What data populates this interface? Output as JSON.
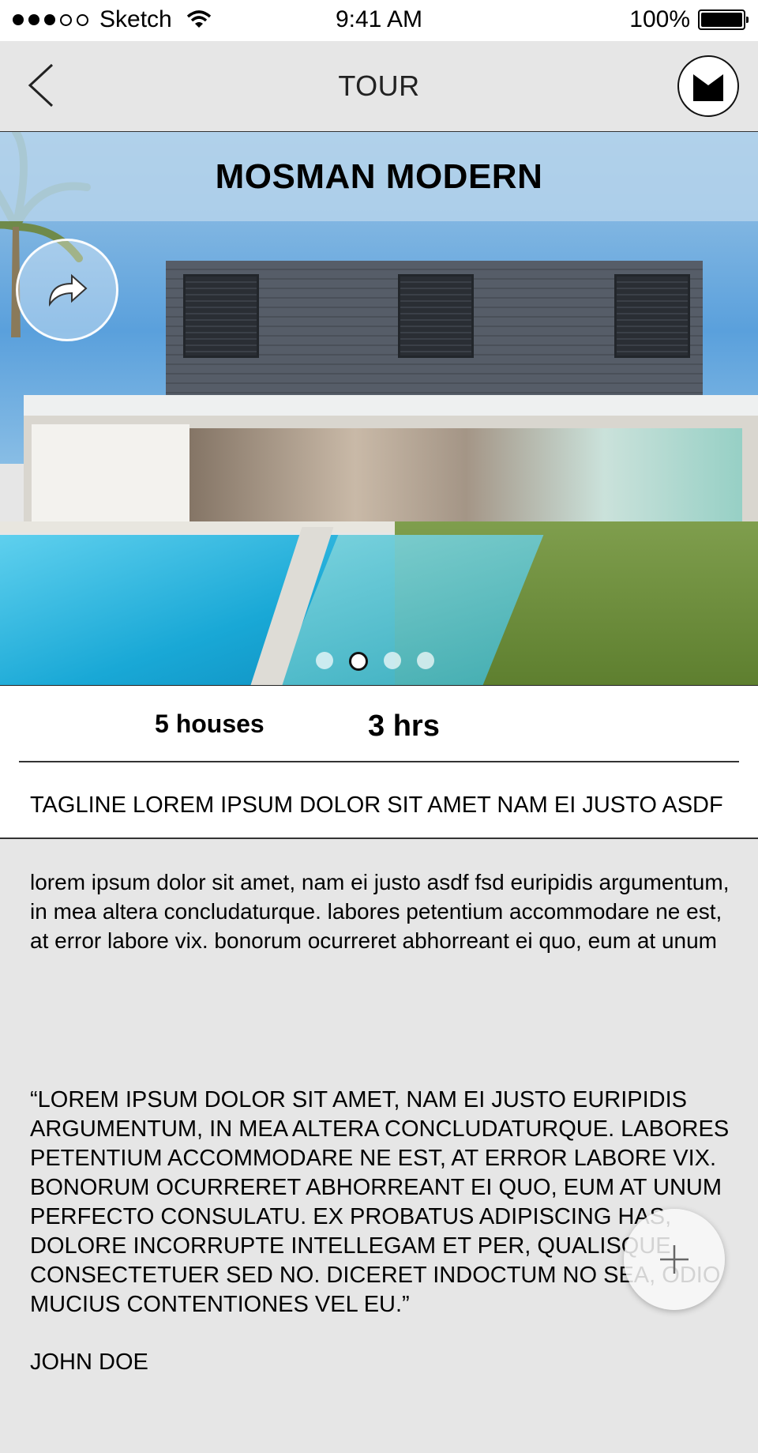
{
  "status_bar": {
    "carrier": "Sketch",
    "time": "9:41 AM",
    "battery": "100%"
  },
  "nav": {
    "title": "TOUR",
    "back_icon": "chevron-left-icon",
    "logo_icon": "brand-logo-icon"
  },
  "hero": {
    "title": "MOSMAN MODERN",
    "share_icon": "share-arrow-icon",
    "page_count": 4,
    "active_page": 2
  },
  "stats": {
    "houses": "5 houses",
    "duration": "3 hrs"
  },
  "content": {
    "tagline": "TAGLINE LOREM IPSUM DOLOR SIT AMET NAM EI JUSTO ASDF",
    "body": "lorem ipsum dolor sit amet, nam ei justo asdf fsd euripidis argumentum, in mea altera concludaturque. labores petentium accommodare ne est, at error labore vix. bonorum ocurreret abhorreant ei quo, eum at unum",
    "quote": "“LOREM IPSUM DOLOR SIT AMET, NAM EI JUSTO EURIPIDIS ARGUMENTUM, IN MEA ALTERA CONCLUDATURQUE. LABORES PETENTIUM ACCOMMODARE NE EST, AT ERROR LABORE VIX. BONORUM OCURRERET ABHORREANT EI QUO, EUM AT UNUM PERFECTO CONSULATU. EX PROBATUS ADIPISCING HAS, DOLORE INCORRUPTE INTELLEGAM ET PER, QUALISQUE CONSECTETUER SED NO. DICERET INDOCTUM NO SEA, ODIO MUCIUS CONTENTIONES VEL EU.”",
    "author": "JOHN DOE"
  },
  "fab": {
    "icon": "plus-icon"
  },
  "colors": {
    "background": "#e6e6e6",
    "card": "#ffffff",
    "text": "#000000"
  }
}
